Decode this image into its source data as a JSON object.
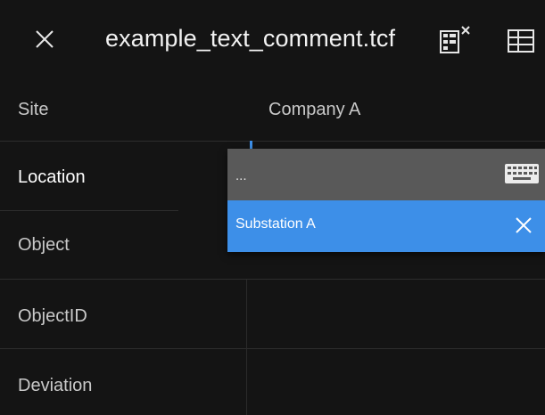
{
  "header": {
    "title": "example_text_comment.tcf",
    "close_icon": "close-icon",
    "icon_1": "clear-form-icon",
    "icon_2": "table-view-icon"
  },
  "rows": [
    {
      "label": "Site",
      "value": "Company A"
    },
    {
      "label": "Location",
      "value": ""
    },
    {
      "label": "Object",
      "value": ""
    },
    {
      "label": "ObjectID",
      "value": ""
    },
    {
      "label": "Deviation",
      "value": ""
    }
  ],
  "dropdown": {
    "input_text": "...",
    "keyboard_icon": "keyboard-icon",
    "option": "Substation A",
    "clear_icon": "close-icon"
  },
  "colors": {
    "background": "#141414",
    "dropdown_input_bg": "#595959",
    "accent": "#3d8fe8",
    "text": "#e6e6e6"
  }
}
